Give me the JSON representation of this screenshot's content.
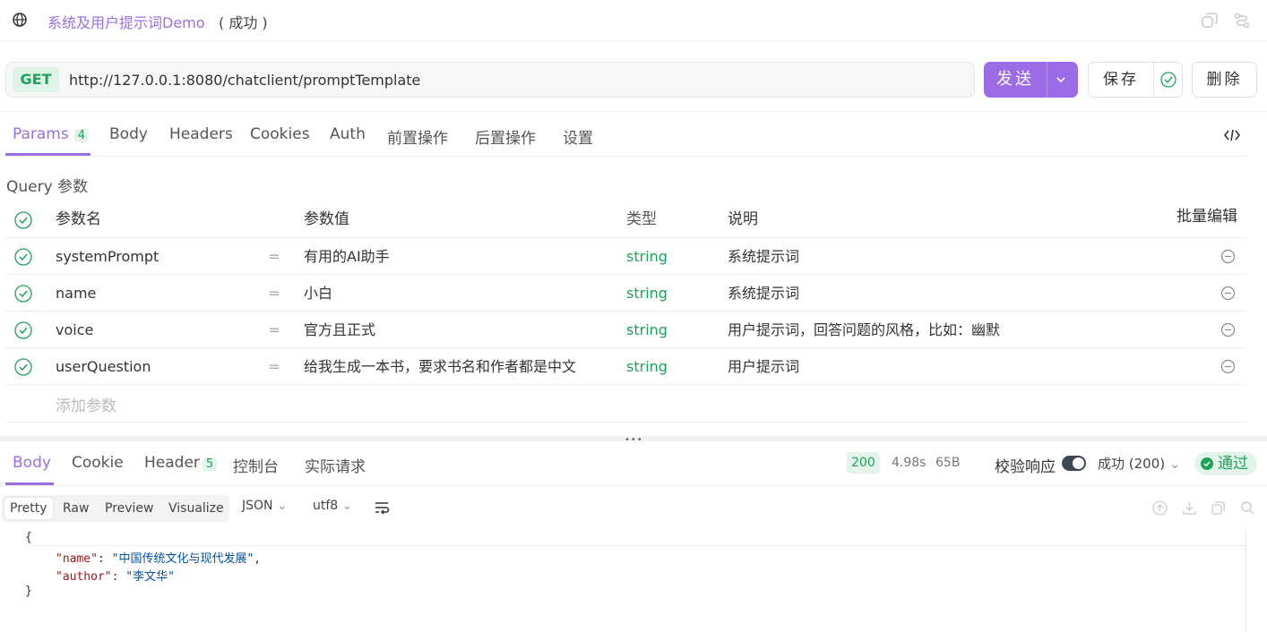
{
  "titlebar": {
    "name": "系统及用户提示词Demo",
    "status": "( 成功 )",
    "icons": [
      "globe-icon",
      "copy-icon",
      "share-icon"
    ]
  },
  "request": {
    "method": "GET",
    "url": "http://127.0.0.1:8080/chatclient/promptTemplate",
    "send_label": "发送",
    "save_label": "保存",
    "delete_label": "删除"
  },
  "tabs": [
    {
      "label": "Params",
      "badge": "4",
      "active": true
    },
    {
      "label": "Body"
    },
    {
      "label": "Headers"
    },
    {
      "label": "Cookies"
    },
    {
      "label": "Auth"
    },
    {
      "label": "前置操作"
    },
    {
      "label": "后置操作"
    },
    {
      "label": "设置"
    }
  ],
  "params": {
    "section_title": "Query 参数",
    "headers": {
      "key": "参数名",
      "value": "参数值",
      "type": "类型",
      "desc": "说明",
      "bulk": "批量编辑"
    },
    "rows": [
      {
        "key": "systemPrompt",
        "eq": "=",
        "value": "有用的AI助手",
        "type": "string",
        "desc": "系统提示词"
      },
      {
        "key": "name",
        "eq": "=",
        "value": "小白",
        "type": "string",
        "desc": "系统提示词"
      },
      {
        "key": "voice",
        "eq": "=",
        "value": "官方且正式",
        "type": "string",
        "desc": "用户提示词，回答问题的风格，比如：幽默"
      },
      {
        "key": "userQuestion",
        "eq": "=",
        "value": "给我生成一本书，要求书名和作者都是中文",
        "type": "string",
        "desc": "用户提示词"
      }
    ],
    "add_placeholder": "添加参数"
  },
  "response": {
    "tabs": [
      {
        "label": "Body",
        "active": true
      },
      {
        "label": "Cookie"
      },
      {
        "label": "Header",
        "badge": "5"
      },
      {
        "label": "控制台"
      },
      {
        "label": "实际请求"
      }
    ],
    "status_code": "200",
    "time": "4.98s",
    "size": "65B",
    "validate_label": "校验响应",
    "result_select": "成功 (200)",
    "pass_label": "通过",
    "formats": [
      "Pretty",
      "Raw",
      "Preview",
      "Visualize"
    ],
    "format_active": "Pretty",
    "lang": "JSON",
    "encoding": "utf8",
    "code": {
      "open": "{",
      "line1_key": "\"name\"",
      "line1_val": "\"中国传统文化与现代发展\"",
      "line2_key": "\"author\"",
      "line2_val": "\"李文华\"",
      "close": "}"
    }
  },
  "colors": {
    "accent": "#9a6fe0",
    "send": "#9c6ce8",
    "success": "#1ca35b"
  }
}
